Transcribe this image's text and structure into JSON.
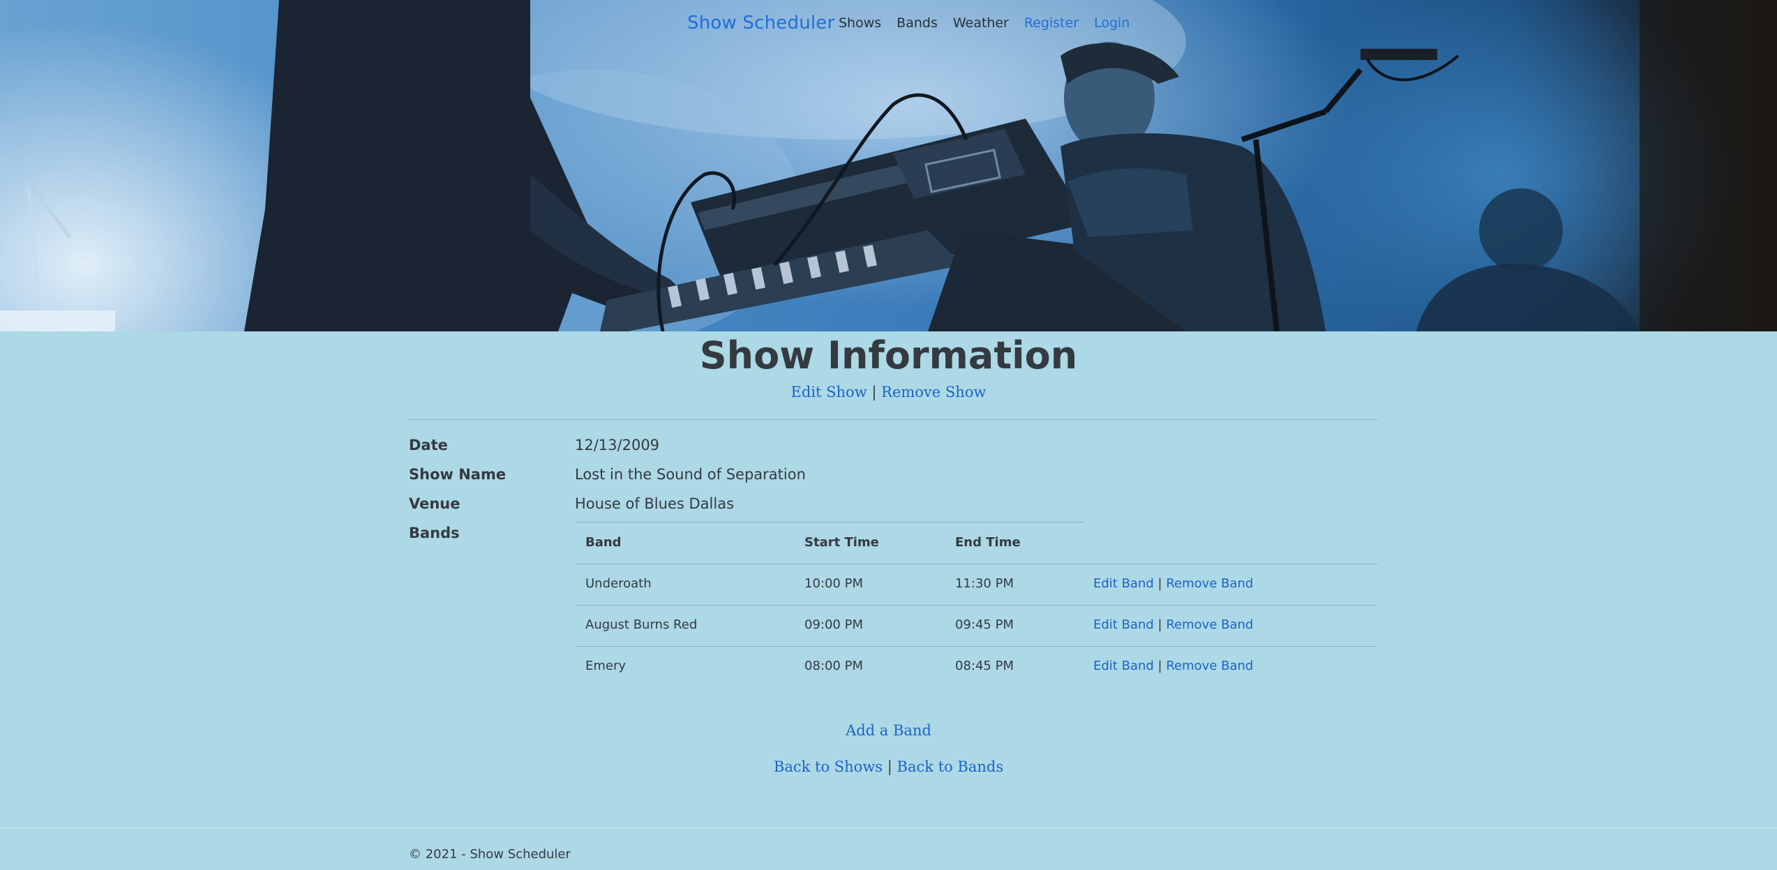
{
  "nav": {
    "brand": "Show Scheduler",
    "links": [
      "Shows",
      "Bands",
      "Weather",
      "Register",
      "Login"
    ]
  },
  "page": {
    "title": "Show Information",
    "edit_show": "Edit Show",
    "separator": "|",
    "remove_show": "Remove Show"
  },
  "details": {
    "date_label": "Date",
    "date_value": "12/13/2009",
    "name_label": "Show Name",
    "name_value": "Lost in the Sound of Separation",
    "venue_label": "Venue",
    "venue_value": "House of Blues Dallas",
    "bands_label": "Bands"
  },
  "bands_table": {
    "headers": [
      "Band",
      "Start Time",
      "End Time"
    ],
    "rows": [
      {
        "band": "Underoath",
        "start": "10:00 PM",
        "end": "11:30 PM",
        "edit": "Edit Band",
        "remove": "Remove Band"
      },
      {
        "band": "August Burns Red",
        "start": "09:00 PM",
        "end": "09:45 PM",
        "edit": "Edit Band",
        "remove": "Remove Band"
      },
      {
        "band": "Emery",
        "start": "08:00 PM",
        "end": "08:45 PM",
        "edit": "Edit Band",
        "remove": "Remove Band"
      }
    ]
  },
  "actions": {
    "add_band": "Add a Band",
    "back_shows": "Back to Shows",
    "back_bands": "Back to Bands"
  },
  "footer": {
    "text": "© 2021 - Show Scheduler"
  },
  "colors": {
    "background": "#add8e6",
    "link": "#1a64c8",
    "text": "#343a40"
  }
}
